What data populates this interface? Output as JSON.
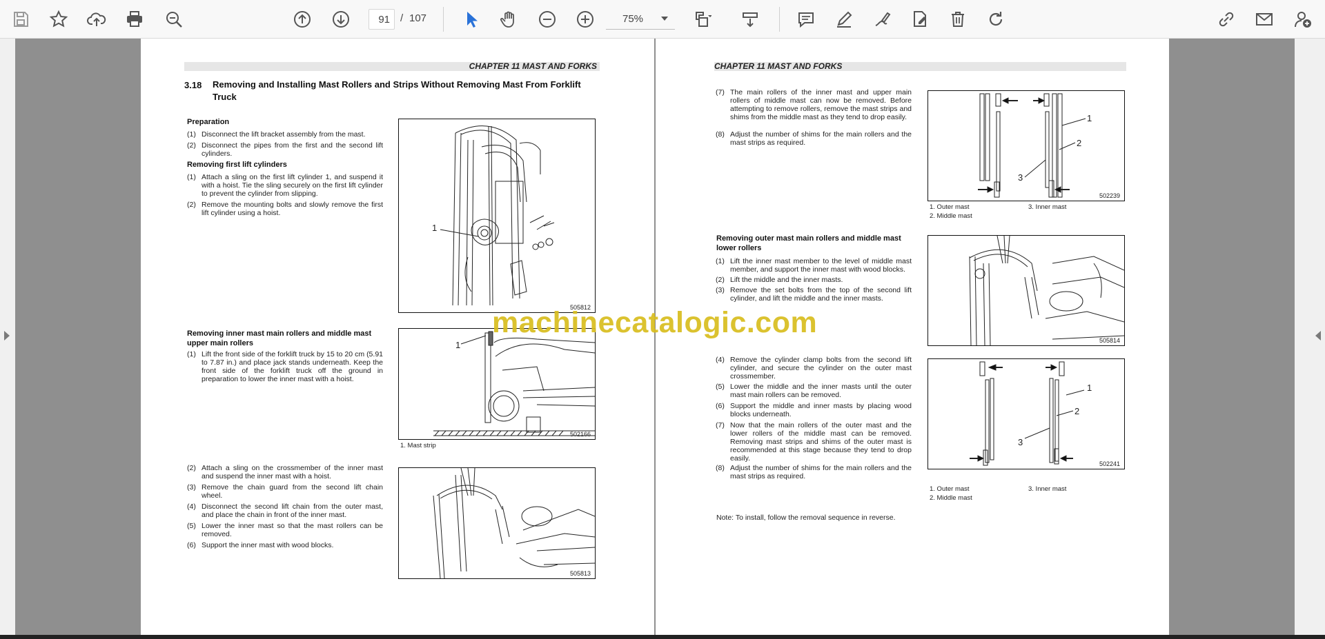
{
  "toolbar": {
    "page_current": "91",
    "page_separator": "/",
    "page_total": "107",
    "zoom": "75%"
  },
  "left_page": {
    "chapter": "CHAPTER 11 MAST AND FORKS",
    "section_number": "3.18",
    "section_title": "Removing and Installing Mast Rollers and Strips Without Removing Mast From Forklift Truck",
    "preparation_heading": "Preparation",
    "preparation_steps": [
      {
        "n": "(1)",
        "text": "Disconnect the lift bracket assembly from the mast."
      },
      {
        "n": "(2)",
        "text": "Disconnect the pipes from the first and the second lift cylinders."
      }
    ],
    "first_lift_heading": "Removing first lift cylinders",
    "first_lift_steps": [
      {
        "n": "(1)",
        "text": "Attach a sling on the first lift cylinder 1, and suspend it with a hoist. Tie the sling securely on the first lift cylinder to prevent the cylinder from slipping."
      },
      {
        "n": "(2)",
        "text": "Remove the mounting bolts and slowly remove the first lift cylinder using a hoist."
      }
    ],
    "inner_mast_heading": "Removing inner mast main rollers and middle mast upper main rollers",
    "inner_mast_steps_a": [
      {
        "n": "(1)",
        "text": "Lift the front side of the forklift truck by 15 to 20 cm (5.91 to 7.87 in.) and place jack stands underneath. Keep the front side of the forklift truck off the ground in preparation to lower the inner mast with a hoist."
      }
    ],
    "inner_mast_steps_b": [
      {
        "n": "(2)",
        "text": "Attach a sling on the crossmember of the inner mast and suspend the inner mast with a hoist."
      },
      {
        "n": "(3)",
        "text": "Remove the chain guard from the second lift chain wheel."
      },
      {
        "n": "(4)",
        "text": "Disconnect the second lift chain from the outer mast, and place the chain in front of the inner mast."
      },
      {
        "n": "(5)",
        "text": "Lower the inner mast so that the mast rollers can be removed."
      },
      {
        "n": "(6)",
        "text": "Support the inner mast with wood blocks."
      }
    ],
    "fig1": {
      "id": "505812",
      "label": "1"
    },
    "fig2": {
      "id": "502166",
      "label": "1",
      "caption": "1. Mast strip"
    },
    "fig3": {
      "id": "505813"
    }
  },
  "right_page": {
    "chapter": "CHAPTER 11 MAST AND FORKS",
    "steps_top": [
      {
        "n": "(7)",
        "text": "The main rollers of the inner mast and upper main rollers of middle mast can now be removed. Before attempting to remove rollers, remove the mast strips and shims from the middle mast as they tend to drop easily."
      },
      {
        "n": "(8)",
        "text": "Adjust the number of shims for the main rollers and the mast strips as required."
      }
    ],
    "outer_mast_heading": "Removing outer mast main rollers and middle mast lower rollers",
    "outer_steps_a": [
      {
        "n": "(1)",
        "text": "Lift the inner mast member to the level of middle mast member, and support the inner mast with wood blocks."
      },
      {
        "n": "(2)",
        "text": "Lift the middle and the inner masts."
      },
      {
        "n": "(3)",
        "text": "Remove the set bolts from the top of the second lift cylinder, and lift the middle and the inner masts."
      }
    ],
    "outer_steps_b": [
      {
        "n": "(4)",
        "text": "Remove the cylinder clamp bolts from the second lift cylinder, and secure the cylinder on the outer mast crossmember."
      },
      {
        "n": "(5)",
        "text": "Lower the middle and the inner masts until the outer mast main rollers can be removed."
      },
      {
        "n": "(6)",
        "text": "Support the middle and inner masts by placing wood blocks underneath."
      },
      {
        "n": "(7)",
        "text": "Now that the main rollers of the outer mast and the lower rollers of the middle mast can be removed. Removing mast strips and shims of the outer mast is recommended at this stage because they tend to drop easily."
      },
      {
        "n": "(8)",
        "text": "Adjust the number of shims for the main rollers and the mast strips as required."
      }
    ],
    "fig4": {
      "id": "502239",
      "labels": [
        "1",
        "2",
        "3"
      ],
      "cap1": "1. Outer mast",
      "cap2": "2. Middle mast",
      "cap3": "3. Inner mast"
    },
    "fig5": {
      "id": "505814"
    },
    "fig6": {
      "id": "502241",
      "labels": [
        "1",
        "2",
        "3"
      ],
      "cap1": "1. Outer mast",
      "cap2": "2. Middle mast",
      "cap3": "3. Inner mast"
    },
    "note": "Note: To install, follow the removal sequence in reverse."
  },
  "watermark": "machinecatalogic.com"
}
